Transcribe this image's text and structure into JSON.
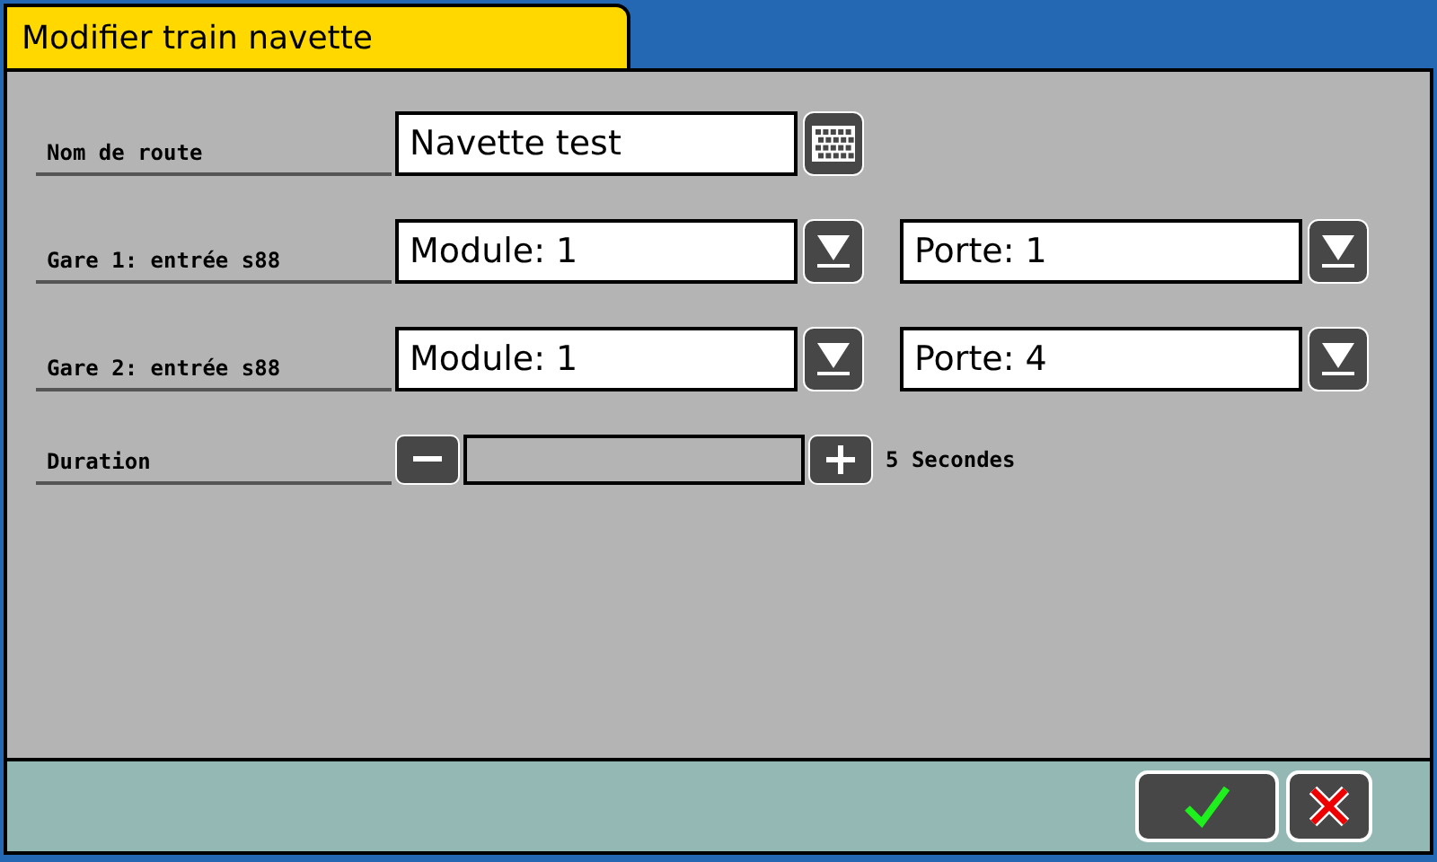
{
  "window": {
    "title": "Modifier train navette"
  },
  "rows": [
    {
      "kind": "text",
      "label": "Nom de route",
      "value": "Navette test"
    },
    {
      "kind": "selects",
      "label": "Gare 1: entrée s88",
      "selects": [
        "Module: 1",
        "Porte: 1"
      ]
    },
    {
      "kind": "selects",
      "label": "Gare 2: entrée s88",
      "selects": [
        "Module: 1",
        "Porte: 4"
      ]
    },
    {
      "kind": "slider",
      "label": "Duration",
      "reading": "5 Secondes"
    }
  ]
}
